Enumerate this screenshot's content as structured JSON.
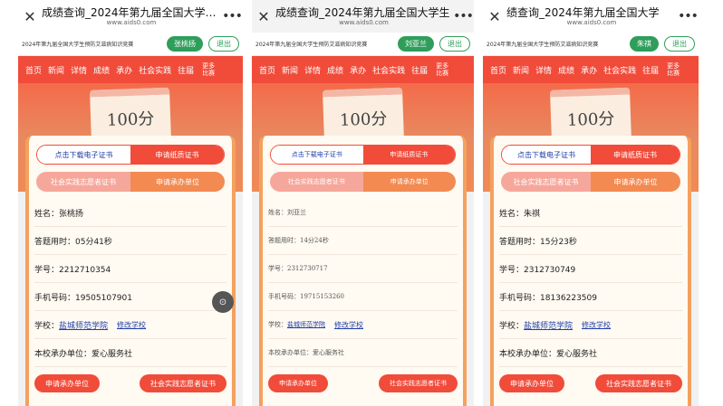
{
  "panels": [
    {
      "title": "成绩查询_2024年第九届全国大学生…",
      "url": "www.aids0.com",
      "close_icon": "close-icon",
      "more_icon": "more-icon",
      "notice": "2024年第九届全国大学生预防艾滋病知识竞赛",
      "user": "张桃扬",
      "logout": "退出",
      "nav": [
        "首页",
        "新闻",
        "详情",
        "成绩",
        "承办",
        "社会实践",
        "往届"
      ],
      "nav_more": "更多比赛",
      "score": "100分",
      "btn_download": "点击下载电子证书",
      "btn_paper": "申请纸质证书",
      "btn_volunteer": "社会实践志愿者证书",
      "btn_host": "申请承办单位",
      "name": "姓名：张桃扬",
      "time": "答题用时：05分41秒",
      "id": "学号：2212710354",
      "phone": "手机号码：19505107901",
      "school_label": "学校：",
      "school": "盐城师范学院",
      "edit_school": "修改学校",
      "host": "本校承办单位：爱心服务社",
      "bottom_left": "申请承办单位",
      "bottom_right": "社会实践志愿者证书"
    },
    {
      "title": "成绩查询_2024年第九届全国大学生",
      "url": "www.aids0.com",
      "close_icon": "close-icon",
      "more_icon": "more-icon",
      "notice": "2024年第九届全国大学生预防艾滋病知识竞赛",
      "user": "刘亚兰",
      "logout": "退出",
      "nav": [
        "首页",
        "新闻",
        "详情",
        "成绩",
        "承办",
        "社会实践",
        "往届"
      ],
      "nav_more": "更多比赛",
      "score": "100分",
      "btn_download": "点击下载电子证书",
      "btn_paper": "申请纸质证书",
      "btn_volunteer": "社会实践志愿者证书",
      "btn_host": "申请承办单位",
      "name": "姓名：刘亚兰",
      "time": "答题用时：14分24秒",
      "id": "学号：2312730717",
      "phone": "手机号码：19715153260",
      "school_label": "学校：",
      "school": "盐城师范学院",
      "edit_school": "修改学校",
      "host": "本校承办单位：爱心服务社",
      "bottom_left": "申请承办单位",
      "bottom_right": "社会实践志愿者证书"
    },
    {
      "title": "绩查询_2024年第九届全国大学",
      "url": "www.aids0.com",
      "close_icon": "close-icon",
      "more_icon": "more-icon",
      "notice": "2024年第九届全国大学生预防艾滋病知识竞赛",
      "user": "朱祺",
      "logout": "退出",
      "nav": [
        "首页",
        "新闻",
        "详情",
        "成绩",
        "承办",
        "社会实践",
        "往届"
      ],
      "nav_more": "更多比赛",
      "score": "100分",
      "btn_download": "点击下载电子证书",
      "btn_paper": "申请纸质证书",
      "btn_volunteer": "社会实践志愿者证书",
      "btn_host": "申请承办单位",
      "name": "姓名：朱祺",
      "time": "答题用时：15分23秒",
      "id": "学号：2312730749",
      "phone": "手机号码：18136223509",
      "school_label": "学校：",
      "school": "盐城师范学院",
      "edit_school": "修改学校",
      "host": "本校承办单位：爱心服务社",
      "bottom_left": "申请承办单位",
      "bottom_right": "社会实践志愿者证书"
    }
  ],
  "lens_icon": "lens-icon",
  "colors": {
    "accent": "#f14b3a",
    "green": "#2f9e5b",
    "link": "#1f3fa8"
  }
}
